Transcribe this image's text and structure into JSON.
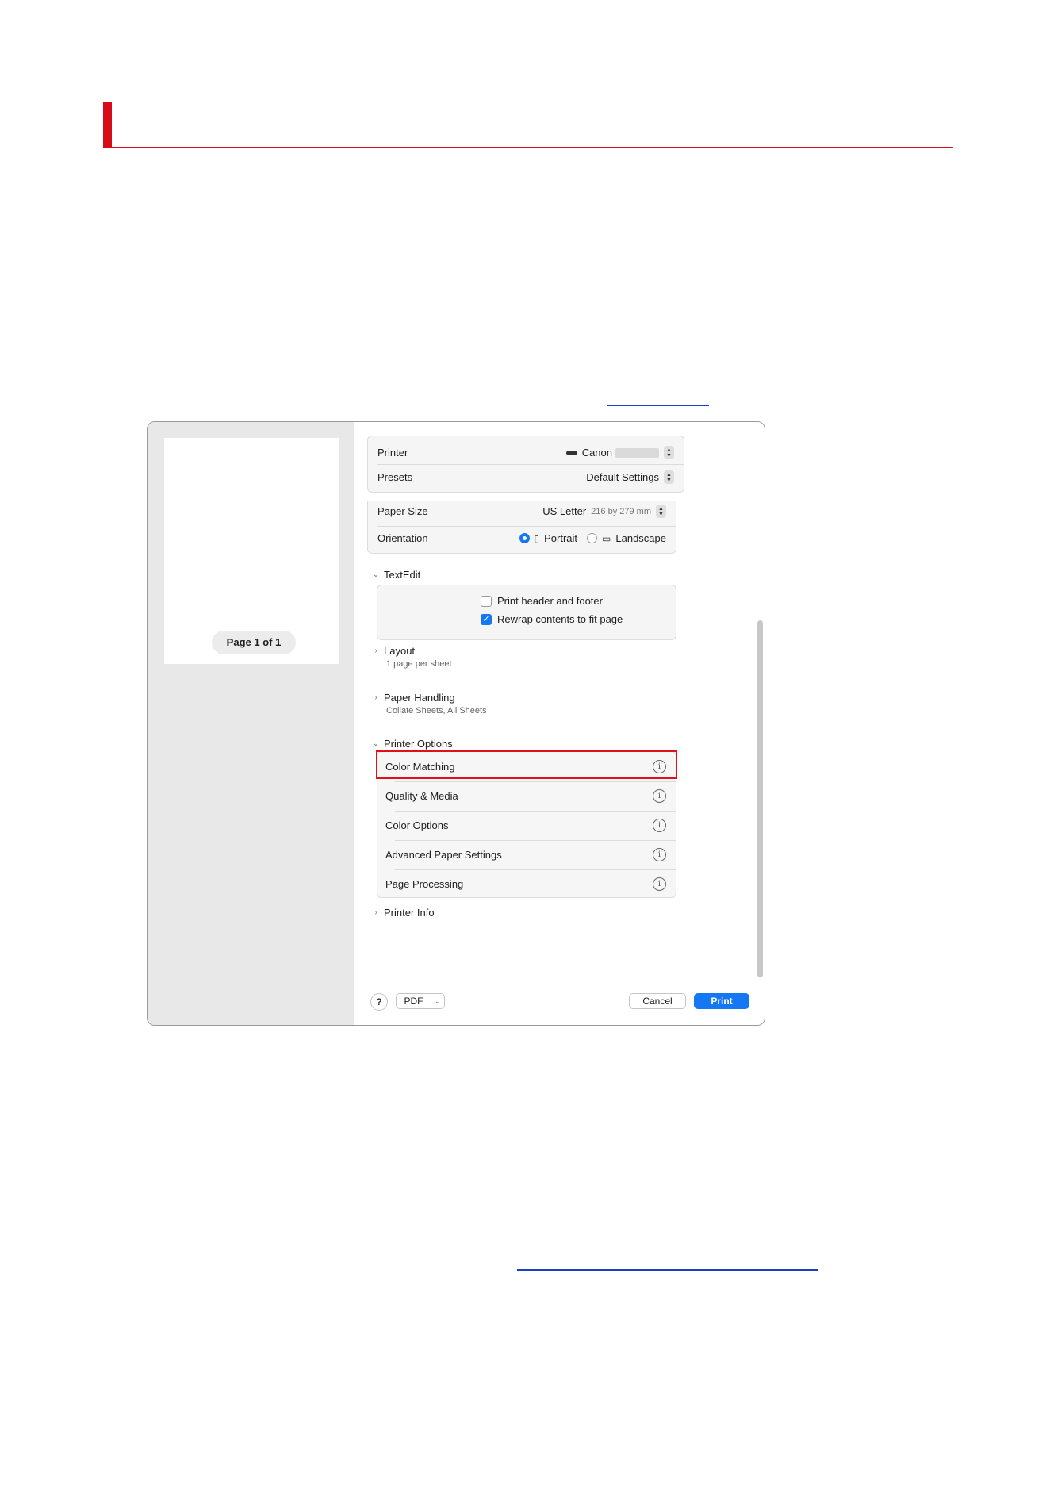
{
  "preview": {
    "page_label": "Page 1 of 1"
  },
  "printer_group": {
    "printer_label": "Printer",
    "printer_value": "Canon",
    "presets_label": "Presets",
    "presets_value": "Default Settings"
  },
  "page_group": {
    "paper_size_label": "Paper Size",
    "paper_size_value": "US Letter",
    "paper_size_dims": "216 by 279 mm",
    "orientation_label": "Orientation",
    "portrait_label": "Portrait",
    "landscape_label": "Landscape",
    "orientation_selected": "Portrait"
  },
  "textedit": {
    "title": "TextEdit",
    "print_header_footer": "Print header and footer",
    "print_header_footer_checked": false,
    "rewrap": "Rewrap contents to fit page",
    "rewrap_checked": true
  },
  "layout": {
    "title": "Layout",
    "subtitle": "1 page per sheet"
  },
  "paper_handling": {
    "title": "Paper Handling",
    "subtitle": "Collate Sheets, All Sheets"
  },
  "printer_options": {
    "title": "Printer Options",
    "items": [
      {
        "label": "Color Matching",
        "highlighted": true
      },
      {
        "label": "Quality & Media"
      },
      {
        "label": "Color Options"
      },
      {
        "label": "Advanced Paper Settings"
      },
      {
        "label": "Page Processing"
      }
    ]
  },
  "printer_info": {
    "title": "Printer Info"
  },
  "footer": {
    "help_label": "?",
    "pdf_label": "PDF",
    "cancel_label": "Cancel",
    "print_label": "Print"
  },
  "colors": {
    "accent": "#d70c18",
    "link": "#1b3fc4",
    "primary_button": "#1677f5",
    "highlight_box": "#e0101a"
  },
  "icons": [
    "chevron-right-icon",
    "chevron-down-icon",
    "info-icon",
    "printer-icon",
    "stepper-icon",
    "checkmark-icon",
    "portrait-icon",
    "landscape-icon"
  ]
}
